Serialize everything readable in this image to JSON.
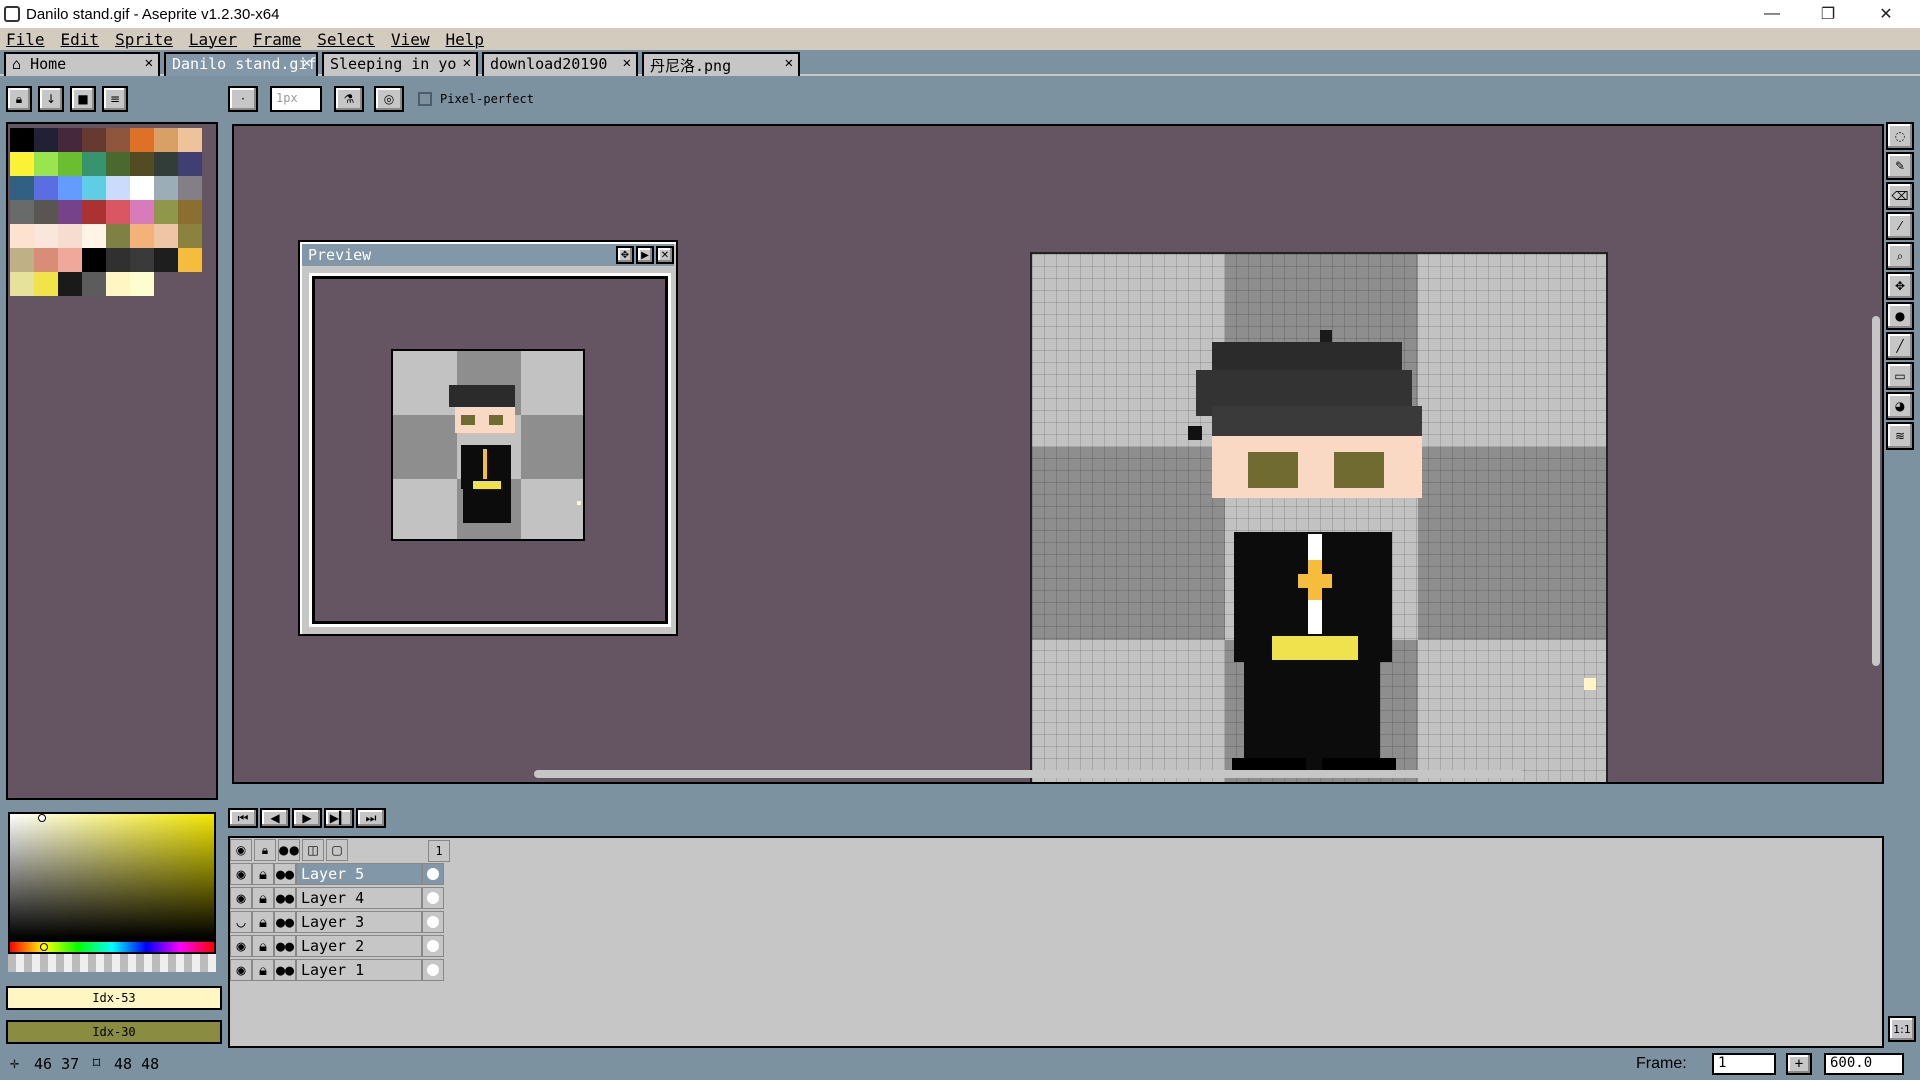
{
  "window": {
    "title": "Danilo stand.gif - Aseprite v1.2.30-x64",
    "minimize": "—",
    "restore": "❐",
    "close": "✕"
  },
  "menu": [
    "File",
    "Edit",
    "Sprite",
    "Layer",
    "Frame",
    "Select",
    "View",
    "Help"
  ],
  "tabs": [
    {
      "label": "Home",
      "active": false
    },
    {
      "label": "Danilo stand.gif",
      "active": true
    },
    {
      "label": "Sleeping in yo",
      "active": false
    },
    {
      "label": "download20190",
      "active": false
    },
    {
      "label": "丹尼洛.png",
      "active": false
    }
  ],
  "toolbar": {
    "brush_size": "1px",
    "pixel_perfect_label": "Pixel-perfect"
  },
  "preview": {
    "title": "Preview"
  },
  "palette": [
    "#000000",
    "#222034",
    "#45283c",
    "#663931",
    "#8f563b",
    "#df7126",
    "#d9a066",
    "#eec39a",
    "#fbf236",
    "#99e550",
    "#6abe30",
    "#37946e",
    "#4b692f",
    "#524b24",
    "#323c39",
    "#3f3f74",
    "#306082",
    "#5b6ee1",
    "#639bff",
    "#5fcde4",
    "#cbdbfc",
    "#ffffff",
    "#9badb7",
    "#847e87",
    "#696a6a",
    "#595652",
    "#76428a",
    "#ac3232",
    "#d95763",
    "#d77bba",
    "#8f974a",
    "#8a6f30",
    "#fde2d0",
    "#fbe6dc",
    "#f6ddd0",
    "#fff4e6",
    "#7f8043",
    "#f4b27a",
    "#f0c5a5",
    "#8b8240",
    "#c0b085",
    "#d98c78",
    "#f0a89a",
    "#000000",
    "#303030",
    "#3a3a3a",
    "#1e1e1e",
    "#f5bd3b",
    "#e6e29c",
    "#f1e448",
    "#1a1a1a",
    "#5c5c5c",
    "#fff6c4",
    "#fffccf"
  ],
  "color_selector": {
    "fg_label": "Idx-53",
    "bg_label": "Idx-30",
    "fg_color": "#fff6c4",
    "bg_color": "#8a8d41"
  },
  "layers": [
    {
      "name": "Layer 5",
      "selected": true,
      "visible": true
    },
    {
      "name": "Layer 4",
      "selected": false,
      "visible": true
    },
    {
      "name": "Layer 3",
      "selected": false,
      "visible": false
    },
    {
      "name": "Layer 2",
      "selected": false,
      "visible": true
    },
    {
      "name": "Layer 1",
      "selected": false,
      "visible": true
    }
  ],
  "timeline": {
    "frame_header": "1"
  },
  "status": {
    "cursor": "46 37",
    "size": "48 48",
    "frame_label": "Frame:",
    "frame_value": "1",
    "zoom": "600.0"
  },
  "colors": {
    "bg": "#7d92a1",
    "canvas": "#655462",
    "panel": "#c6c6c6",
    "accent": "#8297a7"
  }
}
